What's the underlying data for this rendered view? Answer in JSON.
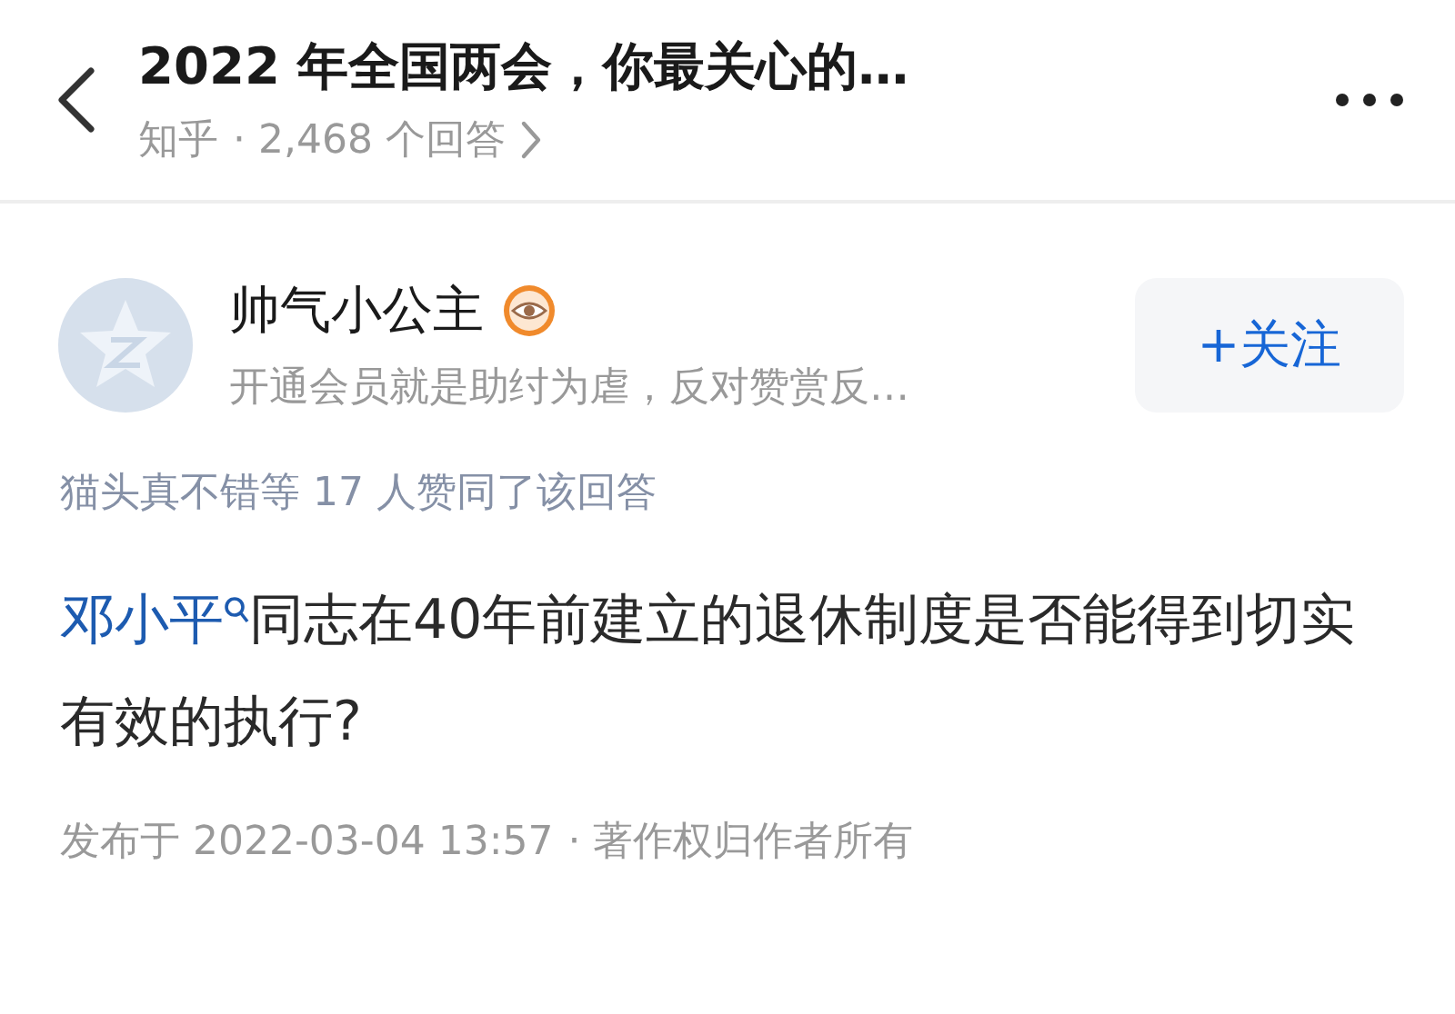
{
  "header": {
    "title": "2022 年全国两会，你最关心的…",
    "source": "知乎",
    "answer_count": "· 2,468 个回答"
  },
  "author": {
    "name": "帅气小公主",
    "bio": "开通会员就是助纣为虐，反对赞赏反…",
    "follow_button": "+关注"
  },
  "upvoters": "猫头真不错等 17 人赞同了该回答",
  "answer": {
    "link": "邓小平",
    "text": "同志在40年前建立的退休制度是否能得到切实有效的执行?"
  },
  "meta": {
    "published": "发布于 2022-03-04 13:57",
    "copyright": "· 著作权归作者所有"
  }
}
